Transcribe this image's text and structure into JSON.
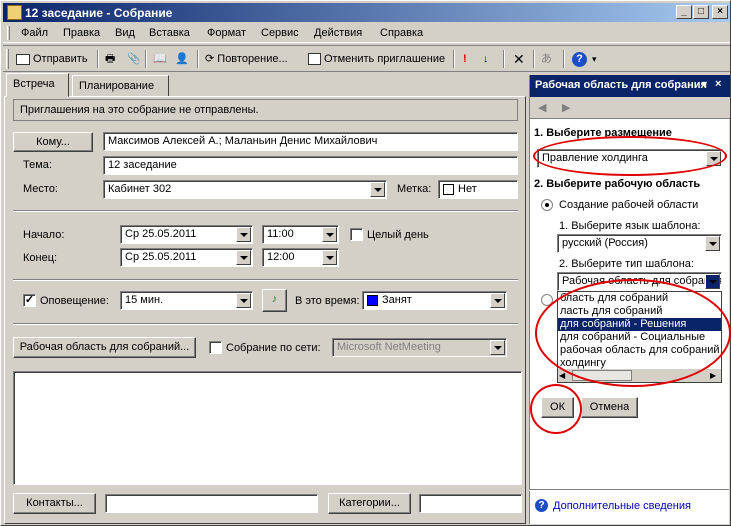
{
  "window": {
    "title": "12 заседание - Собрание",
    "controls": [
      "_",
      "□",
      "×"
    ]
  },
  "menu": [
    "Файл",
    "Правка",
    "Вид",
    "Вставка",
    "Формат",
    "Сервис",
    "Действия",
    "Справка"
  ],
  "toolbar": {
    "send": "Отправить",
    "recurrence": "Повторение...",
    "cancel_invite": "Отменить приглашение",
    "help_arrow": "▾"
  },
  "tabs": [
    "Встреча",
    "Планирование"
  ],
  "info_bar": "Приглашения на это собрание не отправлены.",
  "form": {
    "to_button": "Кому...",
    "to_value": "Максимов Алексей А.; Маланьин Денис Михайлович",
    "subject_label": "Тема:",
    "subject_value": "12 заседание",
    "location_label": "Место:",
    "location_value": "Кабинет 302",
    "label_label": "Метка:",
    "label_value": "Нет",
    "start_label": "Начало:",
    "start_date": "Ср 25.05.2011",
    "start_time": "11:00",
    "allday_label": "Целый день",
    "end_label": "Конец:",
    "end_date": "Ср 25.05.2011",
    "end_time": "12:00",
    "reminder_label": "Оповещение:",
    "reminder_value": "15 мин.",
    "showas_label": "В это время:",
    "showas_value": "Занят",
    "showas_color": "#0000ff",
    "workspace_button": "Рабочая область для собраний...",
    "online_label": "Собрание по сети:",
    "online_value": "Microsoft NetMeeting",
    "contacts_button": "Контакты...",
    "categories_button": "Категории..."
  },
  "pane": {
    "title": "Рабочая область для собрания",
    "step1": "1. Выберите размещение",
    "location": "Правление холдинга",
    "step2": "2. Выберите рабочую область",
    "create_option": "Создание рабочей области",
    "lang_label": "1. Выберите язык шаблона:",
    "lang_value": "русский (Россия)",
    "type_label": "2. Выберите тип шаблона:",
    "type_value": "Рабочая область для собрания",
    "type_options": [
      "бласть для собраний",
      "ласть для собраний",
      "для собраний - Решения",
      "для собраний - Социальные",
      "рабочая область для собраний",
      "холдингу"
    ],
    "ok": "ОК",
    "cancel": "Отмена",
    "more_info": "Дополнительные сведения"
  },
  "colors": {
    "annotation": "#e00000",
    "titlebar": "#0a246a"
  }
}
